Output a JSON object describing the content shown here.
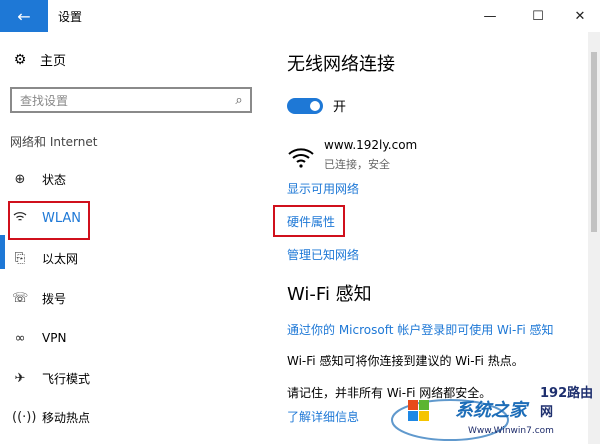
{
  "window": {
    "title": "设置",
    "back": "←",
    "minimize": "—",
    "maximize": "☐",
    "close": "✕"
  },
  "sidebar": {
    "home": "主页",
    "search_placeholder": "查找设置",
    "section": "网络和 Internet",
    "items": [
      {
        "label": "状态",
        "icon": "globe-icon"
      },
      {
        "label": "WLAN",
        "icon": "wifi-icon"
      },
      {
        "label": "以太网",
        "icon": "ethernet-icon"
      },
      {
        "label": "拨号",
        "icon": "dialup-icon"
      },
      {
        "label": "VPN",
        "icon": "vpn-icon"
      },
      {
        "label": "飞行模式",
        "icon": "airplane-icon"
      },
      {
        "label": "移动热点",
        "icon": "hotspot-icon"
      }
    ]
  },
  "content": {
    "heading": "无线网络连接",
    "toggle_label": "开",
    "toggle_on": true,
    "network_name": "www.192ly.com",
    "network_status": "已连接，安全",
    "link_show_networks": "显示可用网络",
    "link_hardware": "硬件属性",
    "link_manage": "管理已知网络",
    "wifi_sense_heading": "Wi-Fi 感知",
    "wifi_sense_link": "通过你的 Microsoft 帐户登录即可使用 Wi-Fi 感知",
    "wifi_sense_text": "Wi-Fi 感知可将你连接到建议的 Wi-Fi 热点。",
    "wifi_sense_note": "请记住，并非所有 Wi-Fi 网络都安全。",
    "learn_more": "了解详细信息"
  },
  "watermark": {
    "brand": "192路由网",
    "text1": "系统之家",
    "text2": "Www.Winwin7.com"
  },
  "colors": {
    "accent": "#1e78d6",
    "highlight": "#d0101c"
  }
}
